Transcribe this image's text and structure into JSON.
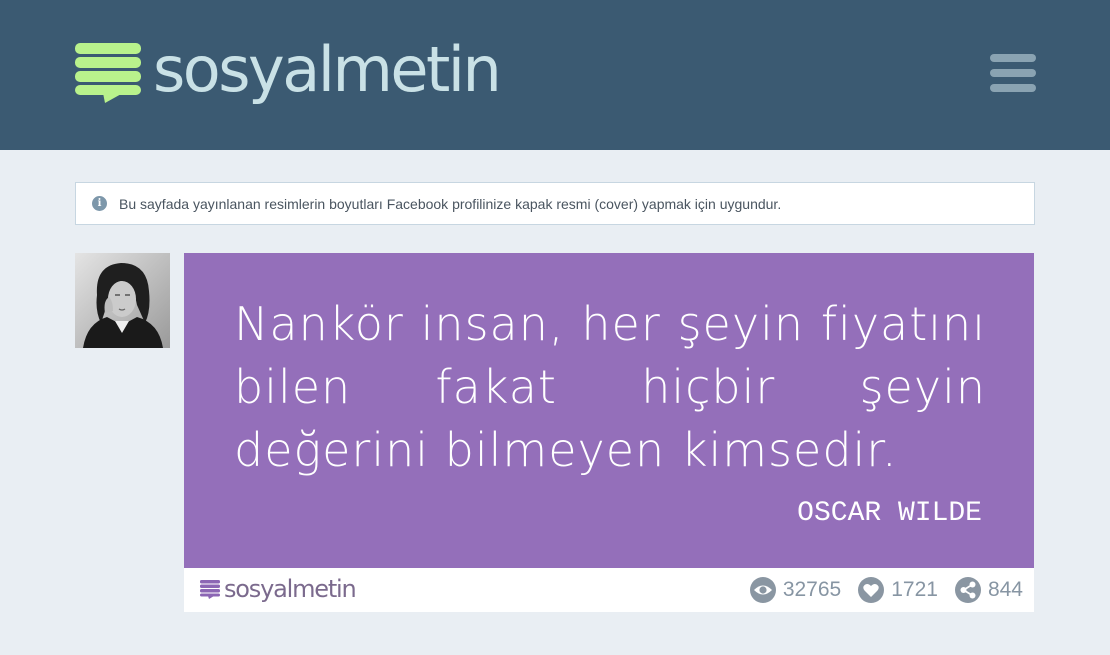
{
  "header": {
    "logo_text": "sosyalmetin",
    "menu_icon": "hamburger-menu-icon"
  },
  "notice": {
    "icon": "info-icon",
    "icon_glyph": "i",
    "text": "Bu sayfada yayınlanan resimlerin boyutları Facebook profilinize kapak resmi (cover) yapmak için uygundur."
  },
  "post": {
    "avatar_alt": "Oscar Wilde",
    "quote": "Nankör insan, her şeyin fiyatını bilen fakat hiçbir şeyin değerini bilmeyen kimsedir.",
    "author": "OSCAR WILDE",
    "footer_logo_text": "sosyalmetin",
    "views": "32765",
    "likes": "1721",
    "shares": "844"
  },
  "colors": {
    "header_bg": "#3b5a72",
    "logo_green": "#b9f28c",
    "logo_text": "#c9e1e6",
    "quote_bg": "#946fba",
    "page_bg": "#e9eef3"
  }
}
